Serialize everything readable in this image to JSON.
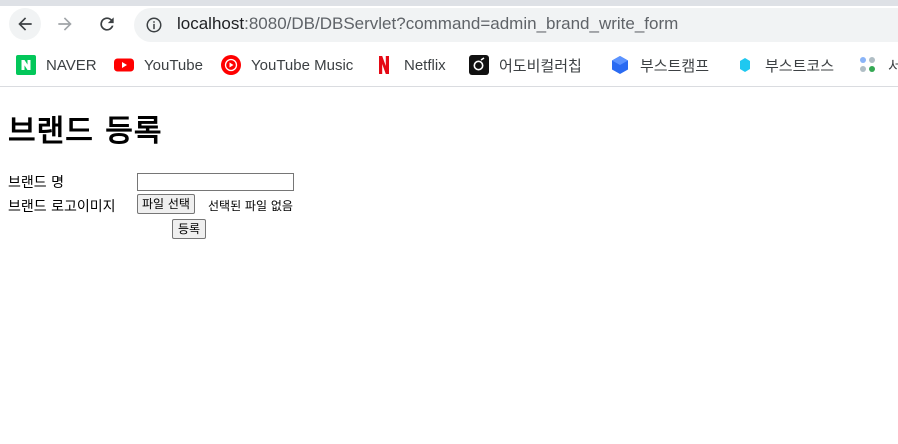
{
  "browser": {
    "url_host": "localhost",
    "url_rest": ":8080/DB/DBServlet?command=admin_brand_write_form"
  },
  "bookmarks": [
    {
      "label": "NAVER",
      "icon": "naver-icon",
      "color": "#03c75a"
    },
    {
      "label": "YouTube",
      "icon": "youtube-icon",
      "color": "#ff0000"
    },
    {
      "label": "YouTube Music",
      "icon": "youtube-music-icon",
      "color": "#ff0000"
    },
    {
      "label": "Netflix",
      "icon": "netflix-icon",
      "color": "#e50914"
    },
    {
      "label": "어도비컬러칩",
      "icon": "adobe-color-icon",
      "color": "#000000"
    },
    {
      "label": "부스트캠프",
      "icon": "boostcamp-icon",
      "color": "#2a6bf2"
    },
    {
      "label": "부스트코스",
      "icon": "boostcourse-icon",
      "color": "#1ec8f0"
    },
    {
      "label": "서",
      "icon": "apps-icon",
      "color": "#8ab4f8"
    }
  ],
  "page": {
    "title": "브랜드 등록",
    "brand_name_label": "브랜드 명",
    "brand_name_value": "",
    "brand_logo_label": "브랜드 로고이미지",
    "file_button_label": "파일 선택",
    "file_status": "선택된 파일 없음",
    "submit_label": "등록"
  }
}
